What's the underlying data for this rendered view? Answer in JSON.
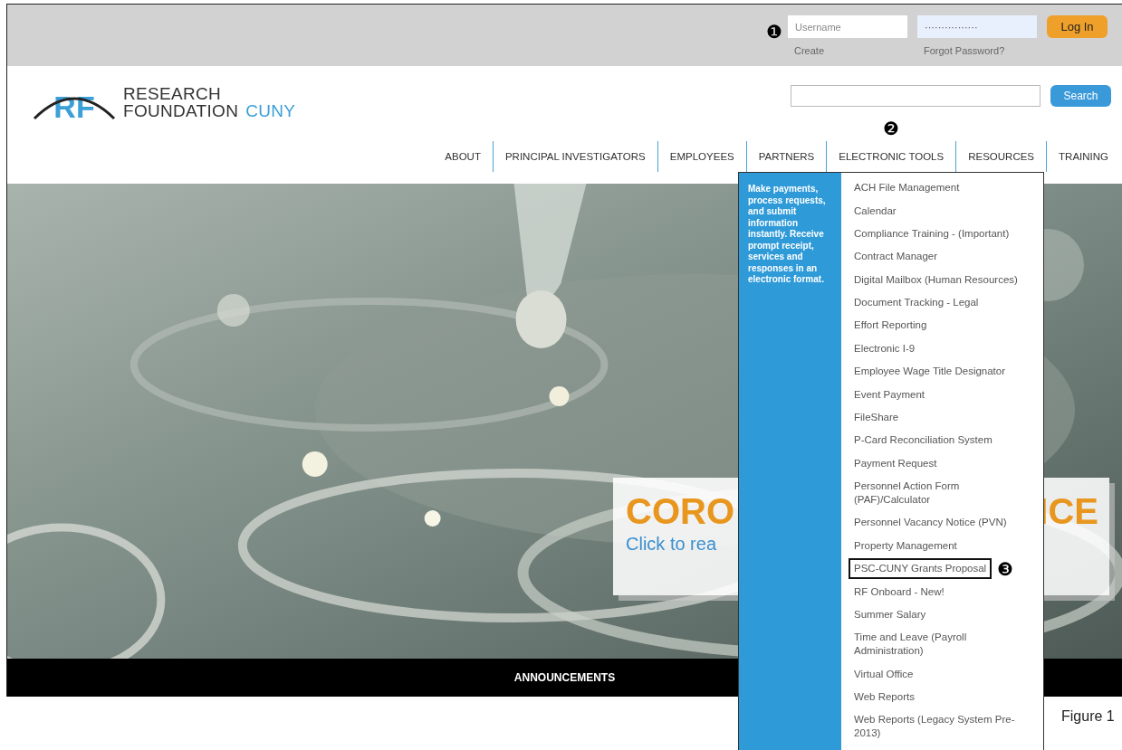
{
  "login": {
    "callout": "❶",
    "username": {
      "placeholder": "Username"
    },
    "password": {
      "value": "················"
    },
    "button": "Log In",
    "links": [
      "Create",
      "Forgot Password?"
    ]
  },
  "logo": {
    "mark": "RF",
    "line1": "RESEARCH",
    "line2": "FOUNDATION",
    "line2_accent": "CUNY"
  },
  "search": {
    "button": "Search"
  },
  "nav": [
    {
      "label": "ABOUT"
    },
    {
      "label": "PRINCIPAL INVESTIGATORS"
    },
    {
      "label": "EMPLOYEES"
    },
    {
      "label": "PARTNERS"
    },
    {
      "label": "ELECTRONIC TOOLS",
      "callout": "❷"
    },
    {
      "label": "RESOURCES"
    },
    {
      "label": "TRAINING"
    }
  ],
  "banner": {
    "headline_left": "CORO",
    "headline_right": "ICE",
    "subtitle": "Click to rea"
  },
  "announcements": "ANNOUNCEMENTS",
  "dropdown": {
    "description": "Make payments, process requests, and submit information instantly. Receive prompt receipt, services and responses in an electronic format.",
    "items": [
      {
        "label": "ACH File Management",
        "outlined": false
      },
      {
        "label": "Calendar",
        "outlined": false
      },
      {
        "label": "Compliance Training - (Important)",
        "outlined": false
      },
      {
        "label": "Contract Manager",
        "outlined": false
      },
      {
        "label": "Digital Mailbox (Human Resources)",
        "outlined": false
      },
      {
        "label": "Document Tracking - Legal",
        "outlined": false
      },
      {
        "label": "Effort Reporting",
        "outlined": false
      },
      {
        "label": "Electronic I-9",
        "outlined": false
      },
      {
        "label": "Employee Wage Title Designator",
        "outlined": false
      },
      {
        "label": "Event Payment",
        "outlined": false
      },
      {
        "label": "FileShare",
        "outlined": false
      },
      {
        "label": "P-Card Reconciliation System",
        "outlined": false
      },
      {
        "label": "Payment Request",
        "outlined": false
      },
      {
        "label": "Personnel Action Form (PAF)/Calculator",
        "outlined": false
      },
      {
        "label": "Personnel Vacancy Notice (PVN)",
        "outlined": false
      },
      {
        "label": "Property Management",
        "outlined": false
      },
      {
        "label": "PSC-CUNY Grants Proposal",
        "outlined": true,
        "callout": "❸"
      },
      {
        "label": "RF Onboard - New!",
        "outlined": false
      },
      {
        "label": "Summer Salary",
        "outlined": false
      },
      {
        "label": "Time and Leave (Payroll Administration)",
        "outlined": false
      },
      {
        "label": "Virtual Office",
        "outlined": false
      },
      {
        "label": "Web Reports",
        "outlined": false
      },
      {
        "label": "Web Reports (Legacy System Pre-2013)",
        "outlined": false
      }
    ]
  },
  "caption": "Figure 1"
}
